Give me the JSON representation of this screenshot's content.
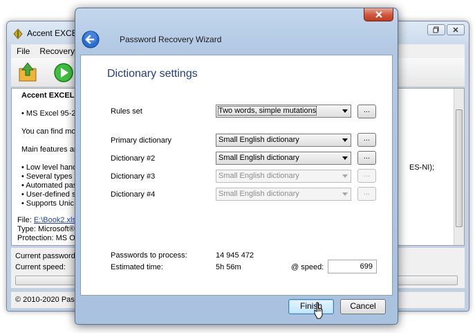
{
  "main_window": {
    "title": "Accent EXCEL",
    "menu": [
      "File",
      "Recovery"
    ],
    "content_lines": [
      "Accent EXCEL",
      "• MS Excel 95-20",
      "You can find mo",
      "Main features ar",
      "• Low level hand",
      "• Several types",
      "• Automated pas",
      "• User-defined s",
      "• Supports Unic",
      "File:",
      "Type: Microsoft®",
      "Protection: MS Of"
    ],
    "file_link": "E:\\Book2.xls",
    "right_fragment": "ES-NI);",
    "status_current_password": "Current password",
    "status_current_speed": "Current speed:",
    "footer": "© 2010-2020 Pass"
  },
  "dialog": {
    "title": "Password Recovery Wizard",
    "heading": "Dictionary settings",
    "fields": [
      {
        "label": "Rules set",
        "value": "Two words, simple mutations",
        "enabled": true
      },
      {
        "label": "Primary dictionary",
        "value": "Small English dictionary",
        "enabled": true
      },
      {
        "label": "Dictionary #2",
        "value": "Small English dictionary",
        "enabled": true
      },
      {
        "label": "Dictionary #3",
        "value": "Small English dictionary",
        "enabled": false
      },
      {
        "label": "Dictionary #4",
        "value": "Small English dictionary",
        "enabled": false
      }
    ],
    "browse_label": "...",
    "passwords_label": "Passwords to process:",
    "passwords_value": "14 945 472",
    "time_label": "Estimated time:",
    "time_value": "5h 56m",
    "speed_label": "@ speed:",
    "speed_value": "699",
    "finish_label": "Finish",
    "cancel_label": "Cancel"
  },
  "colors": {
    "heading": "#1f3d8a",
    "close_button": "#c0391e",
    "dialog_frame": "#b2c9e4"
  }
}
